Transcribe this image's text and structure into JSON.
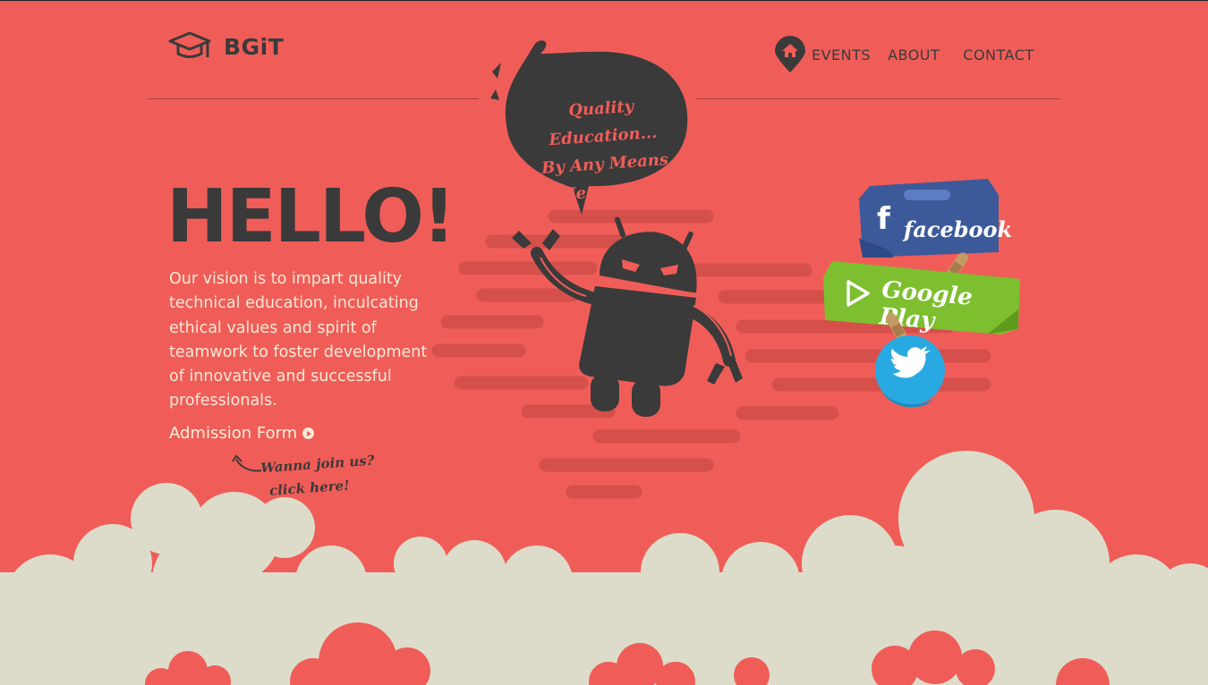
{
  "brand": {
    "name": "BGiT",
    "logo_icon": "graduation-cap-icon"
  },
  "nav": {
    "home_icon": "home-pin-icon",
    "items": [
      {
        "label": "EVENTS"
      },
      {
        "label": "ABOUT"
      },
      {
        "label": "CONTACT"
      }
    ]
  },
  "hero": {
    "bubble_lines": [
      "Quality Education...",
      "By Any Means",
      "Necessary"
    ],
    "heading": "HELLO!",
    "vision": "Our vision is to impart quality technical education, inculcating ethical values and spirit of teamwork to foster development of innovative and successful professionals.",
    "admission_link": "Admission Form",
    "hint_lines": [
      "Wanna join us?",
      "click here!"
    ]
  },
  "social": {
    "facebook": "facebook",
    "google_play": "Google Play",
    "twitter_icon": "twitter-bird-icon"
  },
  "colors": {
    "background": "#f05d58",
    "dark": "#3a3a3a",
    "cloud": "#dddccb",
    "text_light": "#f7e9d6",
    "facebook": "#3c5a9a",
    "google_play": "#7dbf2e",
    "twitter": "#29a9e1"
  }
}
